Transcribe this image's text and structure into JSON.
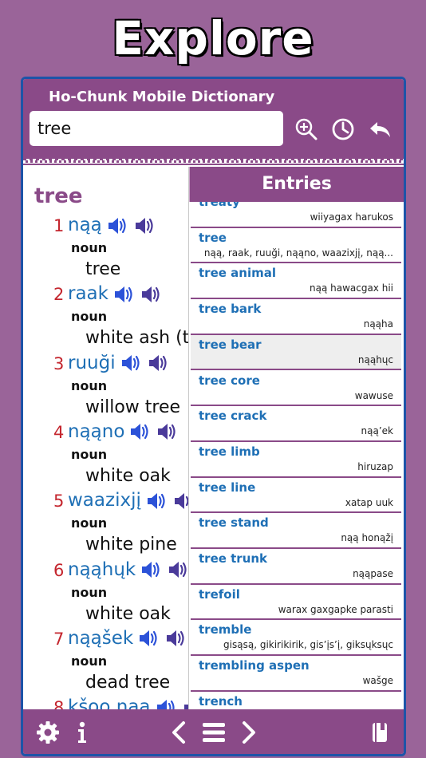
{
  "headline": "Explore",
  "app": {
    "title": "Ho-Chunk Mobile Dictionary",
    "search_value": "tree",
    "icons": [
      "zoom-in-icon",
      "history-clock-icon",
      "back-arrow-icon"
    ]
  },
  "definition": {
    "headword": "tree",
    "senses": [
      {
        "num": "1",
        "word": "nąą",
        "pos": "noun",
        "gloss": "tree"
      },
      {
        "num": "2",
        "word": "raak",
        "pos": "noun",
        "gloss": "white ash (tr"
      },
      {
        "num": "3",
        "word": "ruuği",
        "pos": "noun",
        "gloss": "willow tree"
      },
      {
        "num": "4",
        "word": "nąąno",
        "pos": "noun",
        "gloss": "white oak"
      },
      {
        "num": "5",
        "word": "waazixjį",
        "pos": "noun",
        "gloss": "white pine"
      },
      {
        "num": "6",
        "word": "nąąhųk",
        "pos": "noun",
        "gloss": "white oak"
      },
      {
        "num": "7",
        "word": "nąąšek",
        "pos": "noun",
        "gloss": "dead tree"
      },
      {
        "num": "8",
        "word": "kšoo nąą",
        "pos": "",
        "gloss": ""
      }
    ]
  },
  "entries": {
    "header": "Entries",
    "items": [
      {
        "word": "treaty",
        "trans": "wiiyagax harukos"
      },
      {
        "word": "tree",
        "trans": "nąą, raak, ruuği, nąąno, waazixjį, nąą..."
      },
      {
        "word": "tree animal",
        "trans": "nąą hawacgax hii"
      },
      {
        "word": "tree bark",
        "trans": "nąąha"
      },
      {
        "word": "tree bear",
        "trans": "nąąhųc"
      },
      {
        "word": "tree core",
        "trans": "wawuse"
      },
      {
        "word": "tree crack",
        "trans": "nąą’ek"
      },
      {
        "word": "tree limb",
        "trans": "hiruzap"
      },
      {
        "word": "tree line",
        "trans": "xatap uuk"
      },
      {
        "word": "tree stand",
        "trans": "nąą honąžį"
      },
      {
        "word": "tree trunk",
        "trans": "nąąpase"
      },
      {
        "word": "trefoil",
        "trans": "warax gaxgapke parasti"
      },
      {
        "word": "tremble",
        "trans": "gisąsą, gikirikirik, gis’įs’į, giksųksųc"
      },
      {
        "word": "trembling aspen",
        "trans": "wašge"
      },
      {
        "word": "trench",
        "trans": ""
      }
    ],
    "highlighted_index": 4
  },
  "footer": {
    "icons": [
      "settings-gear-icon",
      "info-icon",
      "previous-chevron-icon",
      "menu-list-icon",
      "next-chevron-icon",
      "notebook-icon"
    ]
  },
  "colors": {
    "background": "#9a6499",
    "header_purple": "#8a4a88",
    "device_border": "#1d54a8",
    "link_blue": "#1e6fb5",
    "number_red": "#c4262e"
  }
}
